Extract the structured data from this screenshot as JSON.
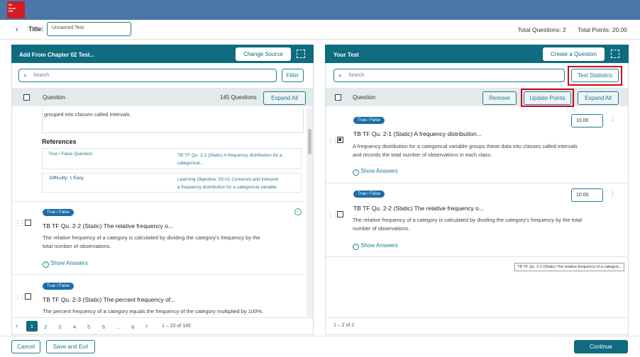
{
  "brand": {
    "logo_text": "Mc Graw Hill Education"
  },
  "header": {
    "title_label": "Title:",
    "title_value": "Unnamed Test",
    "total_questions": "Total Questions: 2",
    "total_points": "Total Points: 20.00"
  },
  "left_panel": {
    "title": "Add From Chapter 02 Test...",
    "change_source": "Change Source",
    "search_placeholder": "Search",
    "filter": "Filter",
    "column_question": "Question",
    "count": "145 Questions",
    "expand_all": "Expand All",
    "partial_text": "the number of observations that fall into each category; it converts numerical variables are grouped into classes called intervals.",
    "partial_text_line2": "grouped into classes called intervals.",
    "references_heading": "References",
    "references": [
      {
        "label": "True / False Question",
        "value": "TB TF Qu. 2-1 (Static) A frequency distribution for a categorical..."
      },
      {
        "label": "Difficulty: 1 Easy",
        "value": "Learning Objective: 02-01 Construct and interpret a frequency distribution for a categorical variable."
      }
    ],
    "ref_value_1a": "TB TF Qu. 2-1 (Static) A frequency distribution for a",
    "ref_value_1b": "categorical...",
    "ref_value_2a": "Learning Objective: 02-01 Construct and interpret",
    "ref_value_2b": "a frequency distribution for a categorical variable",
    "questions": [
      {
        "tag": "True / False",
        "title": "TB TF Qu. 2-2 (Static) The relative frequency o...",
        "text_1": "The relative frequency of a category is calculated by dividing the category's frequency by the",
        "text_2": "total number of observations.",
        "show_answers": "Show Answers"
      },
      {
        "tag": "True / False",
        "title": "TB TF Qu. 2-3 (Static) The percent frequency of...",
        "text_1": "The percent frequency of a category equals the frequency of the category multiplied by 100%."
      }
    ],
    "pagination": {
      "pages": [
        "1",
        "2",
        "3",
        "4",
        "5",
        "6",
        "...",
        "8"
      ],
      "range": "1 – 20 of 145"
    }
  },
  "right_panel": {
    "title": "Your Test",
    "create_question": "Create a Question",
    "search_placeholder": "Search",
    "test_statistics": "Test Statistics",
    "column_question": "Question",
    "remove": "Remove",
    "update_points": "Update Points",
    "expand_all": "Expand All",
    "questions": [
      {
        "tag": "True / False",
        "points": "10.00",
        "title": "TB TF Qu. 2-1 (Static) A frequency distribution...",
        "text_1": "A frequency distribution for a categorical variable groups these data into classes called intervals",
        "text_2": "and records the total number of observations in each class.",
        "show_answers": "Show Answers"
      },
      {
        "tag": "True / False",
        "points": "10.00",
        "title": "TB TF Qu. 2-2 (Static) The relative frequency o...",
        "text_1": "The relative frequency of a category is calculated by dividing the category's frequency by the total",
        "text_2": "number of observations.",
        "show_answers": "Show Answers"
      }
    ],
    "range": "1 – 2 of 2",
    "tooltip": "TB TF Qu. 2-2 (Static) The relative frequency of a category..."
  },
  "footer": {
    "cancel": "Cancel",
    "save_exit": "Save and Exit",
    "continue": "Continue"
  },
  "colors": {
    "topbar": "#4a77a8",
    "panel_header": "#0f6b80",
    "accent": "#1b7c8f",
    "highlight": "#d0021b"
  }
}
